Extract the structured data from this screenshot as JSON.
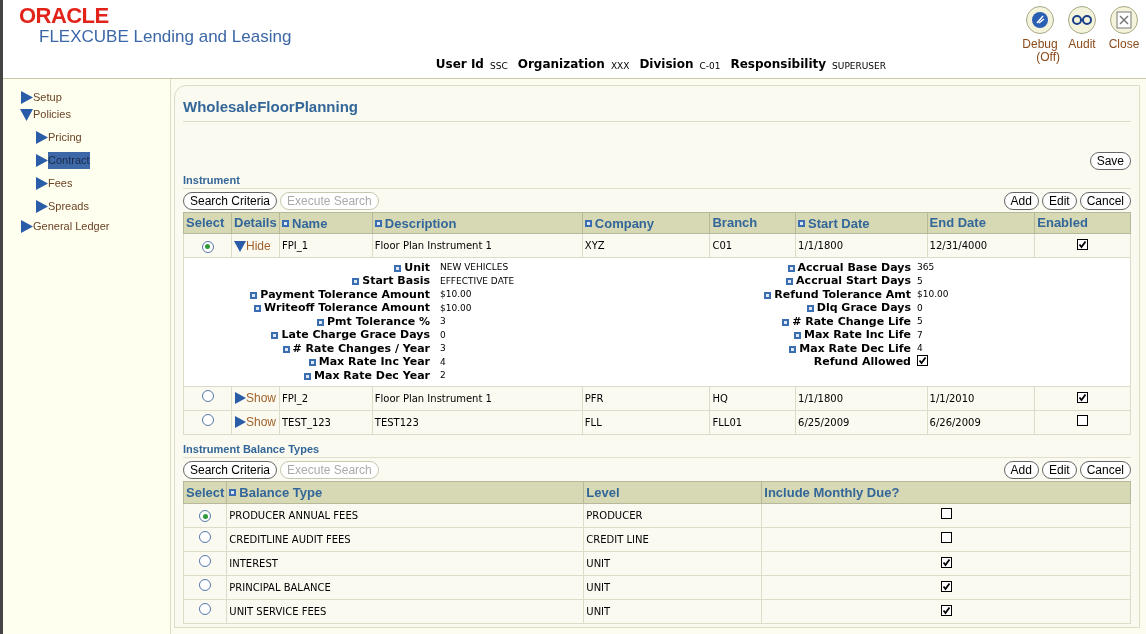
{
  "header": {
    "brand": "ORACLE",
    "product": "FLEXCUBE Lending and Leasing",
    "user_info": [
      {
        "label": "User Id",
        "value": "SSC"
      },
      {
        "label": "Organization",
        "value": "XXX"
      },
      {
        "label": "Division",
        "value": "C-01"
      },
      {
        "label": "Responsibility",
        "value": "SUPERUSER"
      }
    ],
    "actions": [
      {
        "kind": "debug",
        "lines": [
          "Debug",
          "(Off)"
        ]
      },
      {
        "kind": "audit",
        "lines": [
          "Audit"
        ]
      },
      {
        "kind": "close",
        "lines": [
          "Close"
        ]
      }
    ]
  },
  "sidebar": {
    "items": [
      {
        "label": "Setup",
        "expanded": false,
        "selected": false
      },
      {
        "label": "Policies",
        "expanded": true,
        "selected": false,
        "children": [
          {
            "label": "Pricing",
            "expanded": false,
            "selected": false
          },
          {
            "label": "Contract",
            "expanded": false,
            "selected": true
          },
          {
            "label": "Fees",
            "expanded": false,
            "selected": false
          },
          {
            "label": "Spreads",
            "expanded": false,
            "selected": false
          }
        ]
      },
      {
        "label": "General Ledger",
        "expanded": false,
        "selected": false
      }
    ]
  },
  "page": {
    "title": "WholesaleFloorPlanning",
    "save_button": "Save",
    "instrument": {
      "title": "Instrument",
      "left_buttons": [
        {
          "label": "Search Criteria",
          "disabled": false
        },
        {
          "label": "Execute Search",
          "disabled": true
        }
      ],
      "right_buttons": [
        "Add",
        "Edit",
        "Cancel"
      ],
      "columns": [
        {
          "label": "Select",
          "required": false
        },
        {
          "label": "Details",
          "required": false
        },
        {
          "label": "Name",
          "required": true
        },
        {
          "label": "Description",
          "required": true
        },
        {
          "label": "Company",
          "required": true
        },
        {
          "label": "Branch",
          "required": false
        },
        {
          "label": "Start Date",
          "required": true
        },
        {
          "label": "End Date",
          "required": false
        },
        {
          "label": "Enabled",
          "required": false
        }
      ],
      "rows": [
        {
          "selected": true,
          "details": {
            "label": "Hide",
            "expanded": true
          },
          "name": "FPI_1",
          "description": "Floor Plan Instrument 1",
          "company": "XYZ",
          "branch": "C01",
          "start_date": "1/1/1800",
          "end_date": "12/31/4000",
          "enabled": true,
          "detail_left": [
            {
              "label": "Unit",
              "value": "NEW VEHICLES",
              "required": true
            },
            {
              "label": "Start Basis",
              "value": "EFFECTIVE DATE",
              "required": true
            },
            {
              "label": "Payment Tolerance Amount",
              "value": "$10.00",
              "required": true
            },
            {
              "label": "Writeoff Tolerance Amount",
              "value": "$10.00",
              "required": true
            },
            {
              "label": "Pmt Tolerance %",
              "value": "3",
              "required": true
            },
            {
              "label": "Late Charge Grace Days",
              "value": "0",
              "required": true
            },
            {
              "label": "# Rate Changes / Year",
              "value": "3",
              "required": true
            },
            {
              "label": "Max Rate Inc Year",
              "value": "4",
              "required": true
            },
            {
              "label": "Max Rate Dec Year",
              "value": "2",
              "required": true
            }
          ],
          "detail_right": [
            {
              "kind": "text",
              "label": "Accrual Base Days",
              "value": "365",
              "required": true
            },
            {
              "kind": "text",
              "label": "Accrual Start Days",
              "value": "5",
              "required": true
            },
            {
              "kind": "text",
              "label": "Refund Tolerance Amt",
              "value": "$10.00",
              "required": true
            },
            {
              "kind": "text",
              "label": "Dlq Grace Days",
              "value": "0",
              "required": true
            },
            {
              "kind": "text",
              "label": "# Rate Change Life",
              "value": "5",
              "required": true
            },
            {
              "kind": "text",
              "label": "Max Rate Inc Life",
              "value": "7",
              "required": true
            },
            {
              "kind": "text",
              "label": "Max Rate Dec Life",
              "value": "4",
              "required": true
            },
            {
              "kind": "checkbox",
              "label": "Refund Allowed",
              "checked": true,
              "required": false
            }
          ]
        },
        {
          "selected": false,
          "details": {
            "label": "Show",
            "expanded": false
          },
          "name": "FPI_2",
          "description": "Floor Plan Instrument 1",
          "company": "PFR",
          "branch": "HQ",
          "start_date": "1/1/1800",
          "end_date": "1/1/2010",
          "enabled": true
        },
        {
          "selected": false,
          "details": {
            "label": "Show",
            "expanded": false
          },
          "name": "TEST_123",
          "description": "TEST123",
          "company": "FLL",
          "branch": "FLL01",
          "start_date": "6/25/2009",
          "end_date": "6/26/2009",
          "enabled": false
        }
      ]
    },
    "balance_types": {
      "title": "Instrument Balance Types",
      "left_buttons": [
        {
          "label": "Search Criteria",
          "disabled": false
        },
        {
          "label": "Execute Search",
          "disabled": true
        }
      ],
      "right_buttons": [
        "Add",
        "Edit",
        "Cancel"
      ],
      "columns": [
        {
          "label": "Select",
          "required": false
        },
        {
          "label": "Balance Type",
          "required": true
        },
        {
          "label": "Level",
          "required": false
        },
        {
          "label": "Include Monthly Due?",
          "required": false
        }
      ],
      "rows": [
        {
          "selected": true,
          "balance_type": "PRODUCER ANNUAL FEES",
          "level": "PRODUCER",
          "include_monthly_due": false
        },
        {
          "selected": false,
          "balance_type": "CREDITLINE AUDIT FEES",
          "level": "CREDIT LINE",
          "include_monthly_due": false
        },
        {
          "selected": false,
          "balance_type": "INTEREST",
          "level": "UNIT",
          "include_monthly_due": true
        },
        {
          "selected": false,
          "balance_type": "PRINCIPAL BALANCE",
          "level": "UNIT",
          "include_monthly_due": true
        },
        {
          "selected": false,
          "balance_type": "UNIT SERVICE FEES",
          "level": "UNIT",
          "include_monthly_due": true
        }
      ]
    }
  }
}
